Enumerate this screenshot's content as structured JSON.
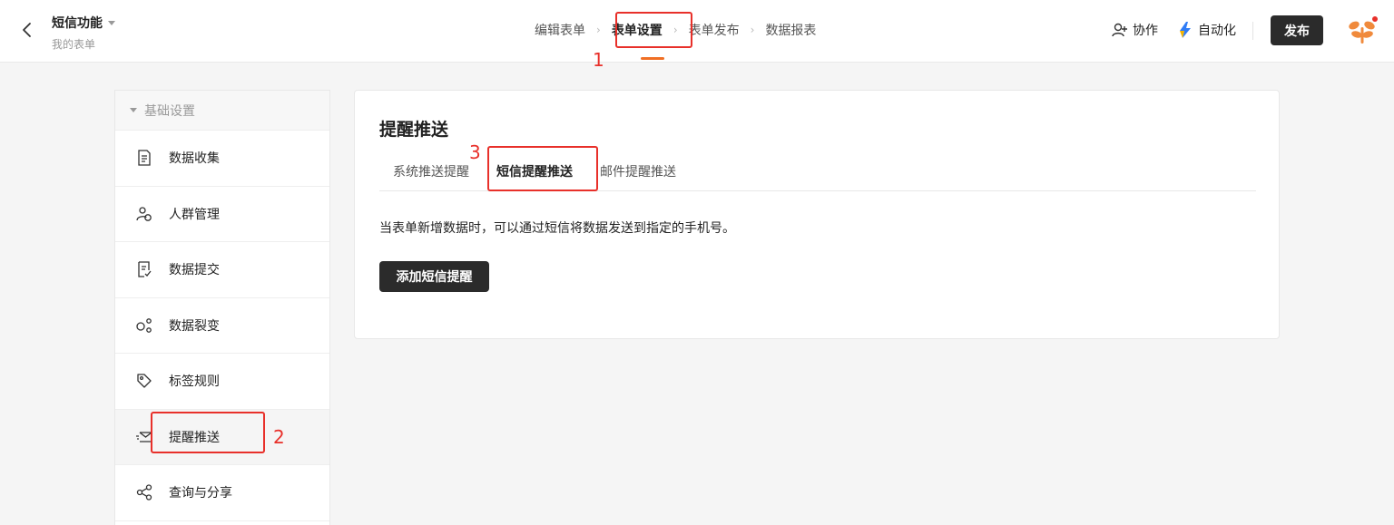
{
  "header": {
    "form_title": "短信功能",
    "form_subtitle": "我的表单",
    "steps": [
      "编辑表单",
      "表单设置",
      "表单发布",
      "数据报表"
    ],
    "collab_label": "协作",
    "automation_label": "自动化",
    "publish_label": "发布"
  },
  "sidebar": {
    "group_label": "基础设置",
    "items": [
      {
        "label": "数据收集",
        "icon": "document-icon"
      },
      {
        "label": "人群管理",
        "icon": "users-icon"
      },
      {
        "label": "数据提交",
        "icon": "submit-doc-icon"
      },
      {
        "label": "数据裂变",
        "icon": "fission-icon"
      },
      {
        "label": "标签规则",
        "icon": "tag-icon"
      },
      {
        "label": "提醒推送",
        "icon": "mail-push-icon"
      },
      {
        "label": "查询与分享",
        "icon": "share-icon"
      }
    ]
  },
  "main": {
    "title": "提醒推送",
    "tabs": [
      "系统推送提醒",
      "短信提醒推送",
      "邮件提醒推送"
    ],
    "description": "当表单新增数据时，可以通过短信将数据发送到指定的手机号。",
    "add_button_label": "添加短信提醒"
  },
  "annotations": [
    "1",
    "2",
    "3"
  ],
  "colors": {
    "accent": "#f06f24",
    "primary_button": "#2b2b2b",
    "annotation": "#e8302a"
  }
}
